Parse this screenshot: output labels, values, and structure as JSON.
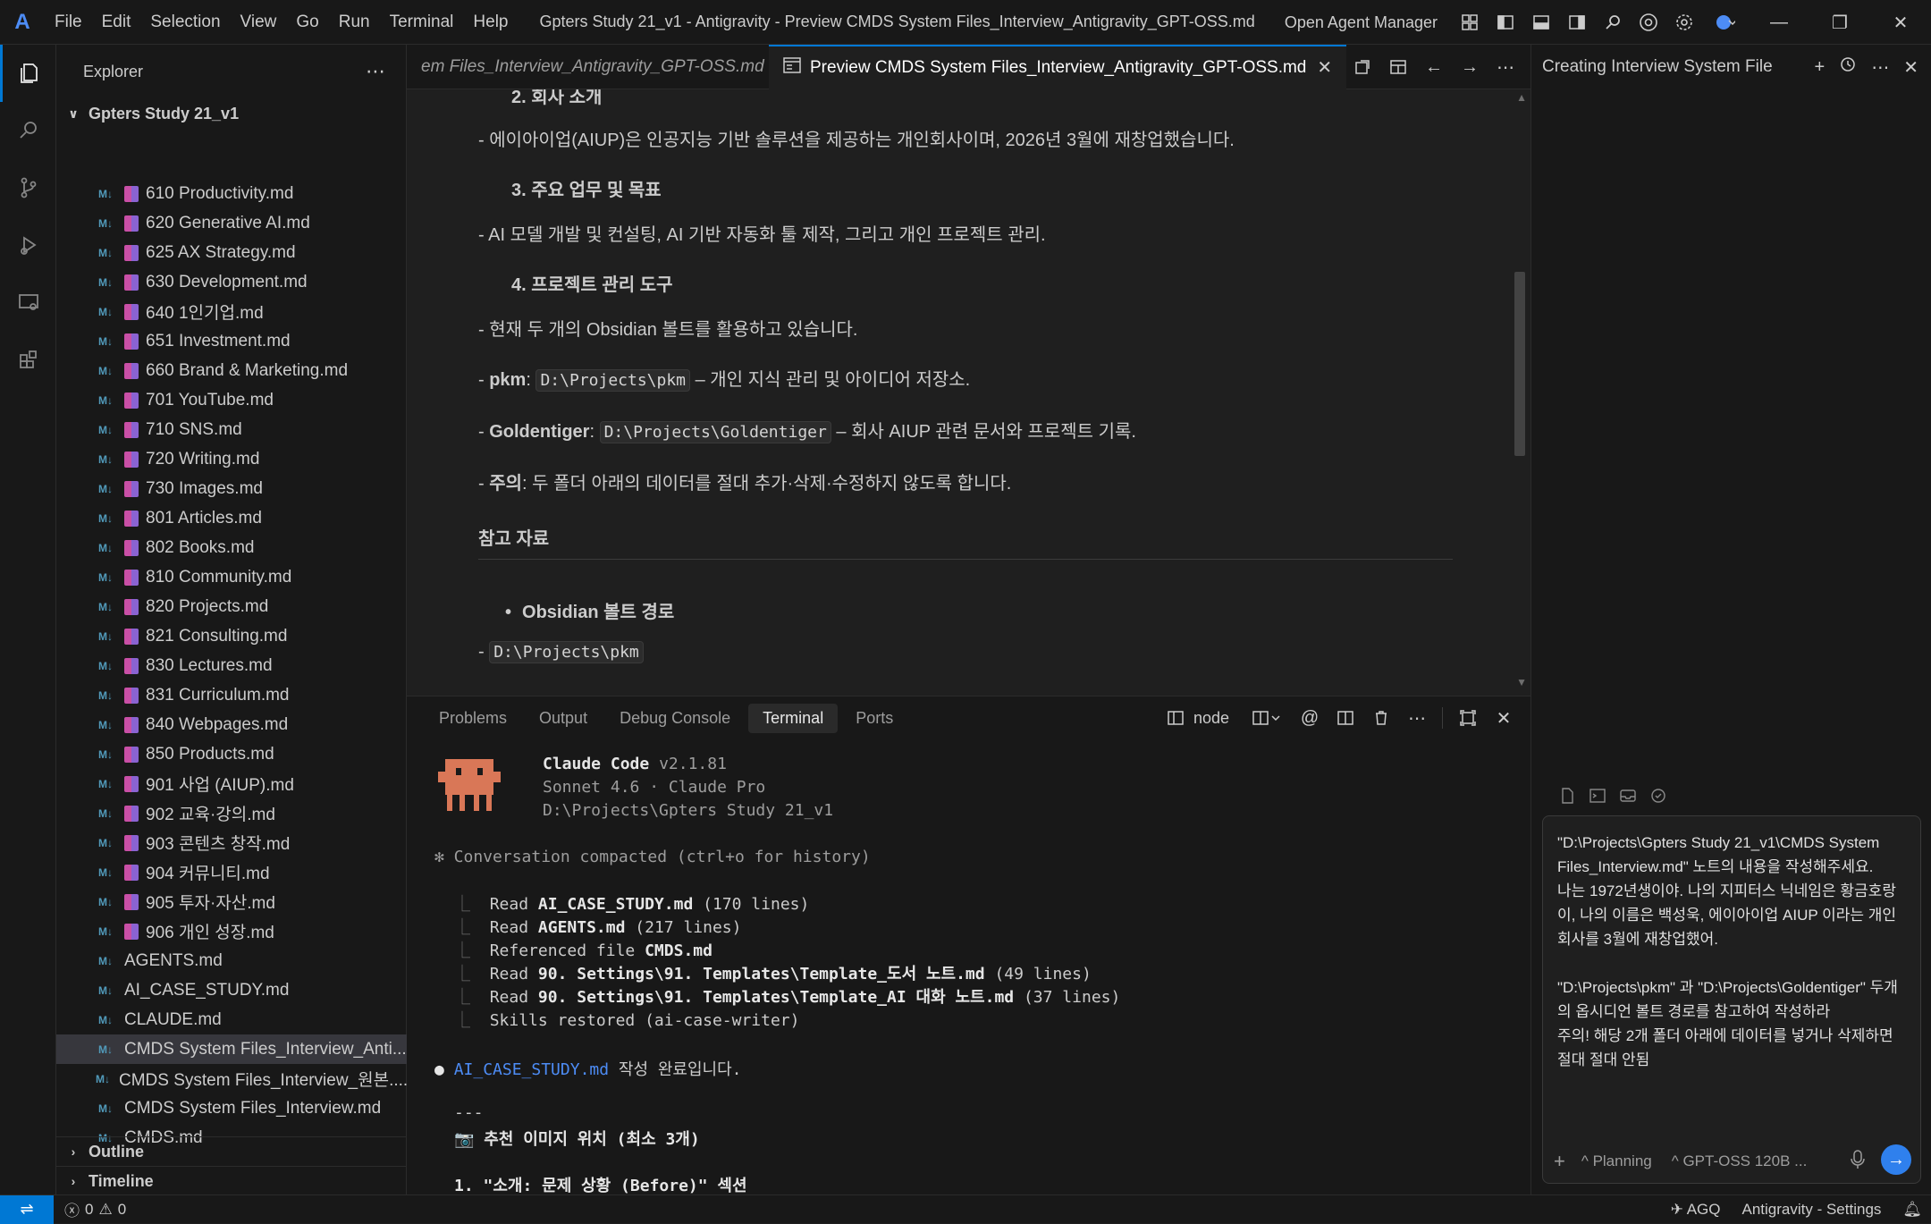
{
  "titlebar": {
    "logo": "A",
    "menus": [
      "File",
      "Edit",
      "Selection",
      "View",
      "Go",
      "Run",
      "Terminal",
      "Help"
    ],
    "window_title": "Gpters Study 21_v1 - Antigravity - Preview CMDS System Files_Interview_Antigravity_GPT-OSS.md",
    "open_agent_manager": "Open Agent Manager"
  },
  "sidebar": {
    "title": "Explorer",
    "folder": "Gpters Study 21_v1",
    "md_badge": "M↓",
    "files": [
      {
        "name": "610 Productivity.md",
        "book": true
      },
      {
        "name": "620 Generative AI.md",
        "book": true
      },
      {
        "name": "625 AX Strategy.md",
        "book": true
      },
      {
        "name": "630 Development.md",
        "book": true
      },
      {
        "name": "640 1인기업.md",
        "book": true
      },
      {
        "name": "651 Investment.md",
        "book": true
      },
      {
        "name": "660 Brand & Marketing.md",
        "book": true
      },
      {
        "name": "701 YouTube.md",
        "book": true
      },
      {
        "name": "710 SNS.md",
        "book": true
      },
      {
        "name": "720 Writing.md",
        "book": true
      },
      {
        "name": "730 Images.md",
        "book": true
      },
      {
        "name": "801 Articles.md",
        "book": true
      },
      {
        "name": "802 Books.md",
        "book": true
      },
      {
        "name": "810 Community.md",
        "book": true
      },
      {
        "name": "820 Projects.md",
        "book": true
      },
      {
        "name": "821 Consulting.md",
        "book": true
      },
      {
        "name": "830 Lectures.md",
        "book": true
      },
      {
        "name": "831 Curriculum.md",
        "book": true
      },
      {
        "name": "840 Webpages.md",
        "book": true
      },
      {
        "name": "850 Products.md",
        "book": true
      },
      {
        "name": "901 사업 (AIUP).md",
        "book": true
      },
      {
        "name": "902 교육·강의.md",
        "book": true
      },
      {
        "name": "903 콘텐츠 창작.md",
        "book": true
      },
      {
        "name": "904 커뮤니티.md",
        "book": true
      },
      {
        "name": "905 투자·자산.md",
        "book": true
      },
      {
        "name": "906 개인 성장.md",
        "book": true
      },
      {
        "name": "AGENTS.md",
        "book": false
      },
      {
        "name": "AI_CASE_STUDY.md",
        "book": false
      },
      {
        "name": "CLAUDE.md",
        "book": false
      },
      {
        "name": "CMDS System Files_Interview_Anti...",
        "book": false,
        "selected": true
      },
      {
        "name": "CMDS System Files_Interview_원본....",
        "book": false
      },
      {
        "name": "CMDS System Files_Interview.md",
        "book": false
      },
      {
        "name": "CMDS.md",
        "book": false
      }
    ],
    "outline": "Outline",
    "timeline": "Timeline"
  },
  "tabs": {
    "inactive": "em Files_Interview_Antigravity_GPT-OSS.md",
    "active": "Preview CMDS System Files_Interview_Antigravity_GPT-OSS.md"
  },
  "preview": {
    "s2_title": "2. 회사 소개",
    "s2_body": "- 에이아이업(AIUP)은 인공지능 기반 솔루션을 제공하는 개인회사이며, 2026년 3월에 재창업했습니다.",
    "s3_title": "3. 주요 업무 및 목표",
    "s3_body": "- AI 모델 개발 및 컨설팅, AI 기반 자동화 툴 제작, 그리고 개인 프로젝트 관리.",
    "s4_title": "4. 프로젝트 관리 도구",
    "s4_body": "- 현재 두 개의 Obsidian 볼트를 활용하고 있습니다.",
    "pkm_label": "pkm",
    "pkm_path": "D:\\Projects\\pkm",
    "pkm_desc": "– 개인 지식 관리 및 아이디어 저장소.",
    "gt_label": "Goldentiger",
    "gt_path": "D:\\Projects\\Goldentiger",
    "gt_desc": "– 회사 AIUP 관련 문서와 프로젝트 기록.",
    "warn_label": "주의",
    "warn_desc": ": 두 폴더 아래의 데이터를 절대 추가·삭제·수정하지 않도록 합니다.",
    "ref_heading": "참고 자료",
    "bullet": "Obsidian 볼트 경로",
    "last_path": "D:\\Projects\\pkm"
  },
  "panel": {
    "tabs": [
      "Problems",
      "Output",
      "Debug Console",
      "Terminal",
      "Ports"
    ],
    "active_tab": "Terminal",
    "shell": "node"
  },
  "terminal": {
    "app_name": "Claude Code",
    "version": "v2.1.81",
    "model": "Sonnet 4.6 · Claude Pro",
    "cwd": "D:\\Projects\\Gpters Study 21_v1",
    "compacted": "✻ Conversation compacted (ctrl+o for history)",
    "ops": [
      {
        "verb": "Read",
        "target": "AI_CASE_STUDY.md",
        "rest": " (170 lines)"
      },
      {
        "verb": "Read",
        "target": "AGENTS.md",
        "rest": " (217 lines)"
      },
      {
        "verb": "Referenced file",
        "target": "CMDS.md",
        "rest": ""
      },
      {
        "verb": "Read",
        "target": "90. Settings\\91. Templates\\Template_도서 노트.md",
        "rest": " (49 lines)"
      },
      {
        "verb": "Read",
        "target": "90. Settings\\91. Templates\\Template_AI 대화 노트.md",
        "rest": " (37 lines)"
      },
      {
        "verb": "Skills restored",
        "target": "",
        "rest": " (ai-case-writer)"
      }
    ],
    "done_file": "AI_CASE_STUDY.md",
    "done_text": " 작성 완료입니다.",
    "rule": "---",
    "rec_heading": "📷 추천 이미지 위치 (최소 3개)",
    "rec_item": "1. \"소개: 문제 상황 (Before)\" 섹션"
  },
  "agent": {
    "title": "Creating Interview System File",
    "message": "\"D:\\Projects\\Gpters Study 21_v1\\CMDS System Files_Interview.md\" 노트의 내용을 작성해주세요.\n나는 1972년생이야. 나의 지피터스 닉네임은 황금호랑이, 나의 이름은 백성욱, 에이아이업 AIUP 이라는 개인회사를 3월에 재창업했어.\n\n\"D:\\Projects\\pkm\" 과 \"D:\\Projects\\Goldentiger\" 두개의 옵시디언 볼트 경로를 참고하여 작성하라\n주의! 해당 2개 폴더 아래에 데이터를 넣거나 삭제하면 절대 절대 안됨",
    "mode": "Planning",
    "model": "GPT-OSS 120B ..."
  },
  "statusbar": {
    "errors": "0",
    "warnings": "0",
    "agq": "AGQ",
    "settings": "Antigravity - Settings"
  }
}
